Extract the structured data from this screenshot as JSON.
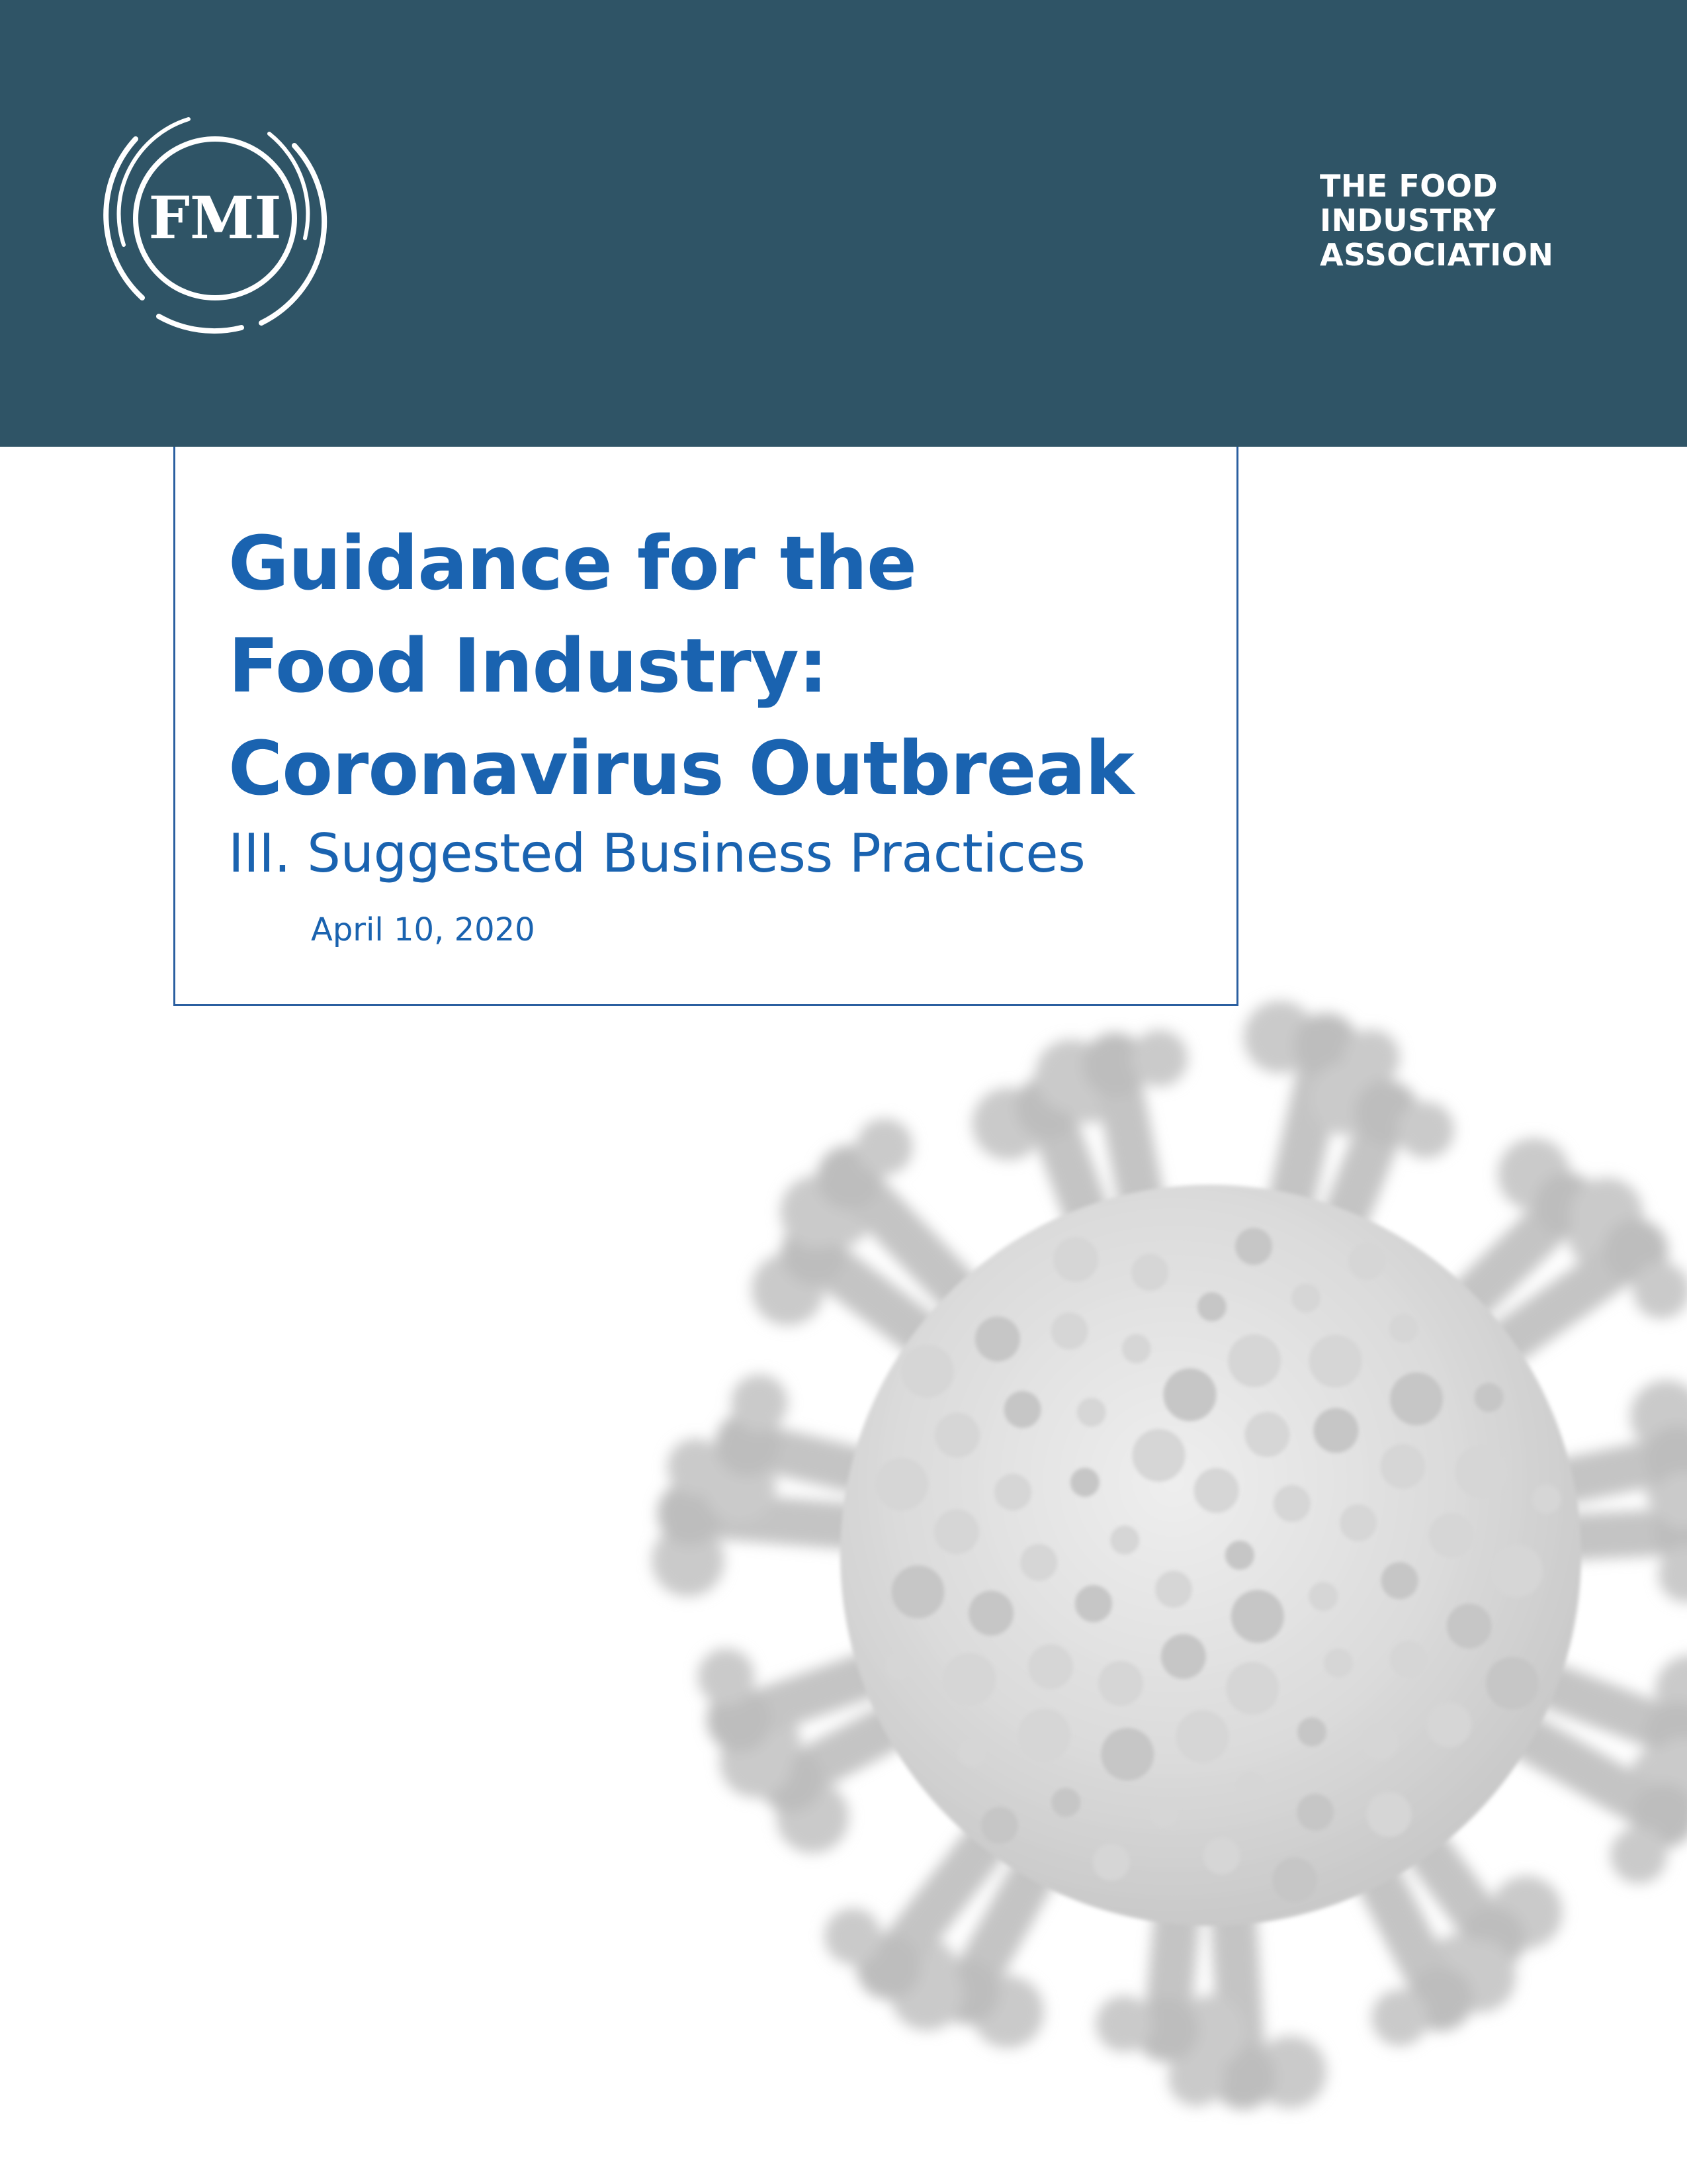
{
  "header": {
    "logo_text": "FMI",
    "tagline": [
      "THE FOOD",
      "INDUSTRY",
      "ASSOCIATION"
    ]
  },
  "cover": {
    "title_lines": [
      "Guidance for the",
      "Food Industry:",
      "Coronavirus Outbreak"
    ],
    "subtitle": "III. Suggested Business Practices",
    "date": "April 10, 2020"
  },
  "colors": {
    "header_band": "#2f5466",
    "title_blue": "#1a63b0",
    "box_border": "#2b5fa0",
    "virus_gray": "#c8c8c8"
  },
  "icons": {
    "logo": "fmi-logo-icon",
    "illustration": "coronavirus-illustration"
  }
}
